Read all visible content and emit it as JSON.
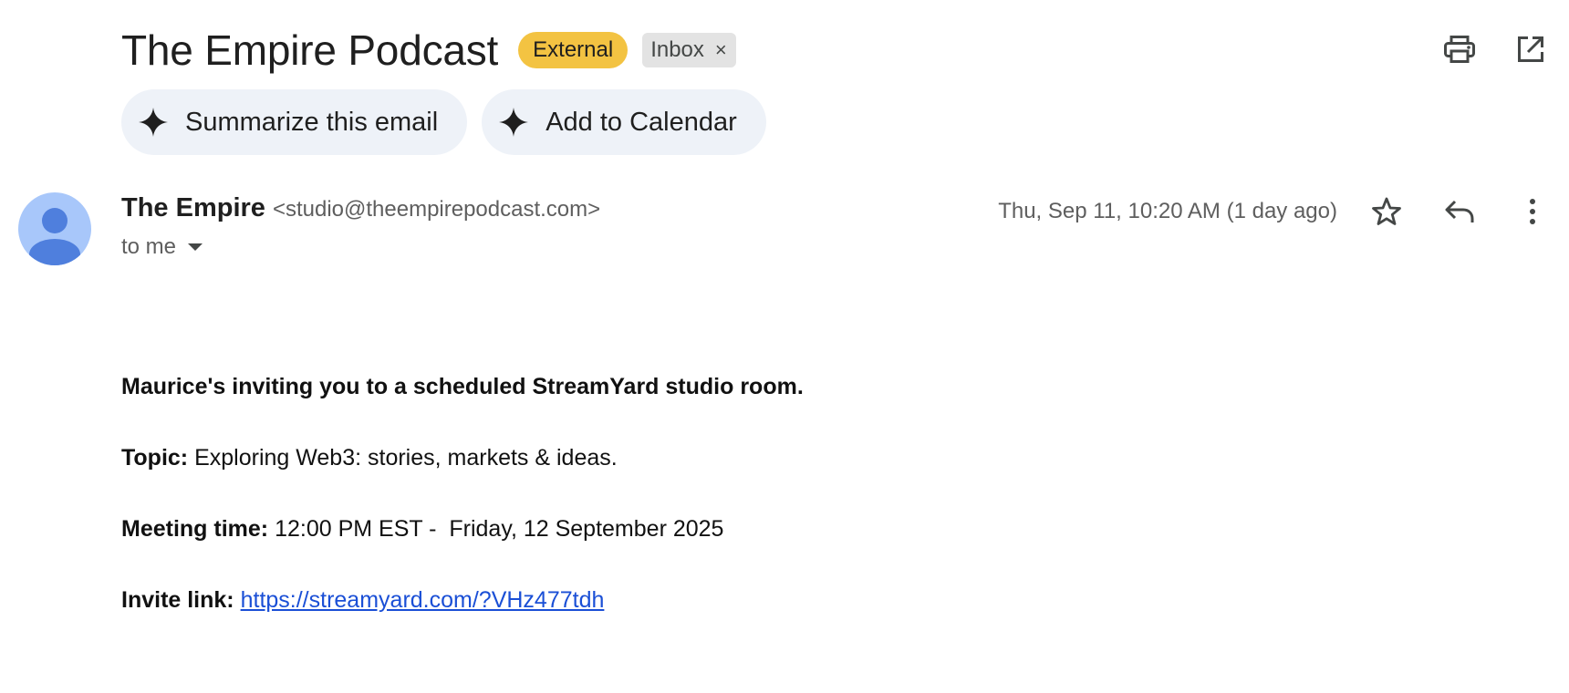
{
  "subject": "The Empire Podcast",
  "labels": {
    "external": "External",
    "inbox": "Inbox",
    "inbox_remove": "×"
  },
  "top_icons": [
    "print-icon",
    "open-in-new-window-icon"
  ],
  "gemini_chips": [
    {
      "label": "Summarize this email",
      "icon": "sparkle-icon"
    },
    {
      "label": "Add to Calendar",
      "icon": "sparkle-icon"
    }
  ],
  "sender": {
    "name": "The Empire",
    "email": "<studio@theempirepodcast.com>",
    "to": "to me",
    "date": "Thu, Sep 11, 10:20 AM (1 day ago)"
  },
  "header_icons": [
    "star-icon",
    "reply-icon",
    "more-vertical-icon"
  ],
  "body": {
    "intro": "Maurice's inviting you to a scheduled StreamYard studio room.",
    "topic_label": "Topic:",
    "topic_value": " Exploring Web3: stories, markets & ideas.",
    "time_label": "Meeting time:",
    "time_value": " 12:00 PM EST -  Friday, 12 September 2025",
    "link_label": "Invite link:",
    "link_url": "https://streamyard.com/?VHz477tdh"
  },
  "colors": {
    "external_badge": "#f3c342",
    "inbox_badge": "#e3e3e3",
    "chip_bg": "#eef2f8",
    "avatar_bg": "#a8c7fa",
    "avatar_fg": "#4f7fdd",
    "link": "#1a4fd6"
  }
}
